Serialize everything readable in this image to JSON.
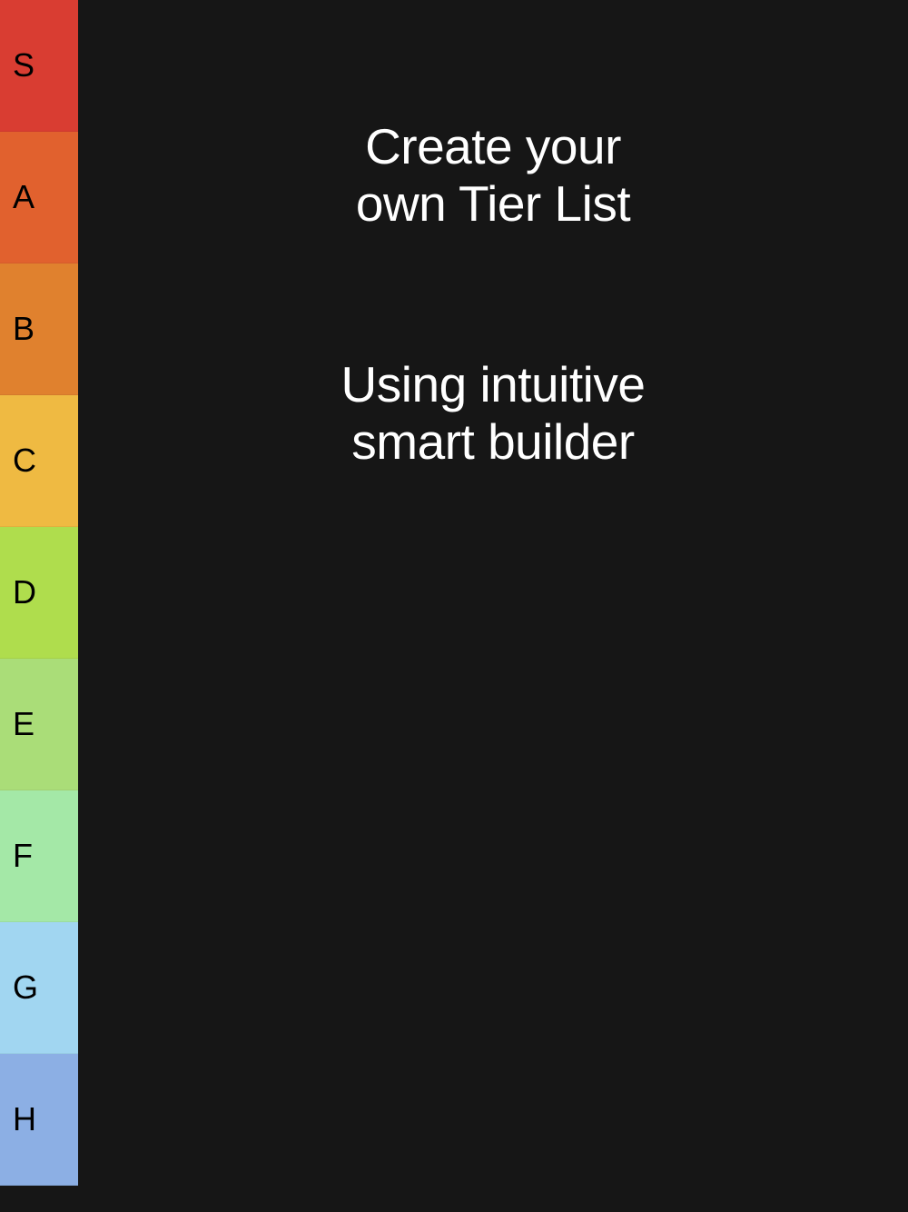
{
  "tiers": [
    {
      "label": "S",
      "color": "#D93D32"
    },
    {
      "label": "A",
      "color": "#E1612E"
    },
    {
      "label": "B",
      "color": "#E0812E"
    },
    {
      "label": "C",
      "color": "#EFBA42"
    },
    {
      "label": "D",
      "color": "#AFDD4D"
    },
    {
      "label": "E",
      "color": "#AADD78"
    },
    {
      "label": "F",
      "color": "#A4E8A7"
    },
    {
      "label": "G",
      "color": "#A1D6F1"
    },
    {
      "label": "H",
      "color": "#8CAFE4"
    }
  ],
  "heading_line1": "Create your",
  "heading_line2": "own Tier List",
  "subheading_line1": "Using intuitive",
  "subheading_line2": "smart builder"
}
